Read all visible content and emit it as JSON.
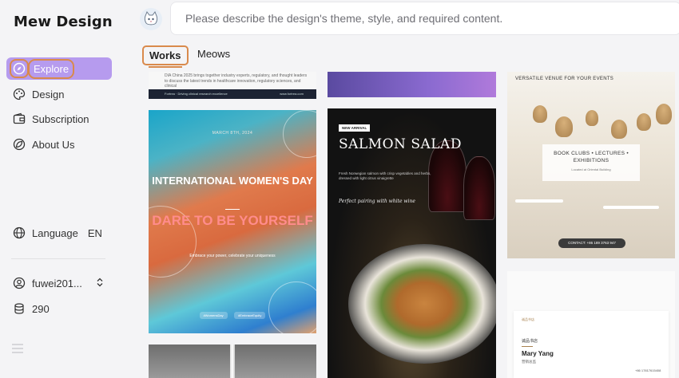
{
  "app": {
    "brand": "Mew Design"
  },
  "sidebar": {
    "items": [
      {
        "label": "Explore",
        "icon": "compass-icon",
        "active": true
      },
      {
        "label": "Design",
        "icon": "palette-icon"
      },
      {
        "label": "Subscription",
        "icon": "wallet-icon"
      },
      {
        "label": "About Us",
        "icon": "leaf-icon"
      }
    ],
    "language": {
      "label": "Language",
      "code": "EN",
      "icon": "globe-icon"
    },
    "user": {
      "name": "fuwei201...",
      "icon": "user-icon"
    },
    "credits": {
      "value": "290",
      "icon": "coins-icon"
    }
  },
  "header": {
    "search_placeholder": "Please describe the design's theme, style, and required content."
  },
  "tabs": [
    {
      "label": "Works",
      "active": true
    },
    {
      "label": "Meows",
      "active": false
    }
  ],
  "gallery": {
    "card1": {
      "text": "DIA China 2025 brings together industry experts, regulatory, and thought leaders to discuss the latest trends in healthcare innovation, regulatory sciences, and clinical",
      "footer_left": "Fortrea · Driving clinical research excellence",
      "footer_right": "www.fortrea.com"
    },
    "card3": {
      "header": "VERSATILE VENUE FOR YOUR EVENTS",
      "box_title": "BOOK CLUBS • LECTURES • EXHIBITIONS",
      "box_sub": "Located at Oriental Building",
      "contact": "CONTACT: +86 189 3763 947"
    },
    "card4": {
      "date": "MARCH 8TH, 2024",
      "title": "INTERNATIONAL WOMEN'S DAY",
      "slogan": "DARE TO BE YOURSELF",
      "sub": "Embrace your power, celebrate your uniqueness",
      "tags": [
        "#WomensDay",
        "#EmbraceEquity"
      ]
    },
    "card5": {
      "badge": "NEW ARRIVAL",
      "title": "SALMON SALAD",
      "desc": "Fresh Norwegian salmon with crisp vegetables and herbs, dressed with light citrus vinaigrette",
      "italic": "Perfect pairing with white wine"
    },
    "card7": {
      "small": "诚品书店",
      "cn": "诚品书店",
      "name": "Mary Yang",
      "role": "营销总监",
      "phone": "+86 17817615408"
    }
  },
  "colors": {
    "accent": "#b69bee",
    "highlight": "#d98a4c"
  }
}
